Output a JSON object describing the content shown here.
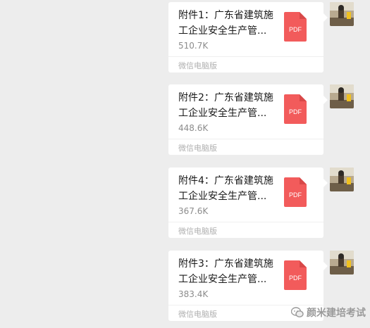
{
  "messages": [
    {
      "file_name": "附件1：广东省建筑施工企业安全生产管...",
      "size": "510.7K",
      "source": "微信电脑版",
      "icon": "pdf-icon",
      "icon_label": "PDF"
    },
    {
      "file_name": "附件2：广东省建筑施工企业安全生产管...",
      "size": "448.6K",
      "source": "微信电脑版",
      "icon": "pdf-icon",
      "icon_label": "PDF"
    },
    {
      "file_name": "附件4：广东省建筑施工企业安全生产管...",
      "size": "367.6K",
      "source": "微信电脑版",
      "icon": "pdf-icon",
      "icon_label": "PDF"
    },
    {
      "file_name": "附件3：广东省建筑施工企业安全生产管...",
      "size": "383.4K",
      "source": "微信电脑版",
      "icon": "pdf-icon",
      "icon_label": "PDF"
    }
  ],
  "watermark": {
    "text": "颜米建培考试",
    "icon": "wechat-official-account-icon"
  },
  "colors": {
    "background": "#ededed",
    "card": "#ffffff",
    "pdf": "#f25b5b"
  }
}
